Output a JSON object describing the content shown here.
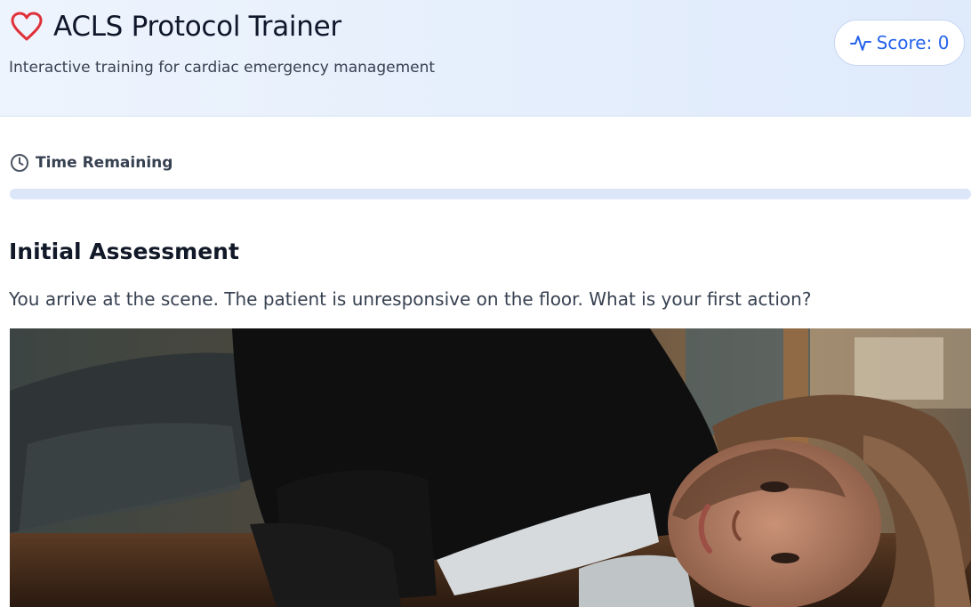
{
  "header": {
    "title": "ACLS Protocol Trainer",
    "subtitle": "Interactive training for cardiac emergency management",
    "logo_icon": "heart-icon",
    "score": {
      "label": "Score: 0",
      "icon": "pulse-icon",
      "value": 0
    }
  },
  "timer": {
    "label": "Time Remaining",
    "icon": "clock-icon",
    "progress_fraction": 1.0
  },
  "scenario": {
    "title": "Initial Assessment",
    "question": "You arrive at the scene. The patient is unresponsive on the floor. What is your first action?"
  },
  "colors": {
    "accent": "#2563eb",
    "heart": "#e0313a",
    "header_bg": "#e6effc",
    "progress_track": "#dbe7f8"
  }
}
